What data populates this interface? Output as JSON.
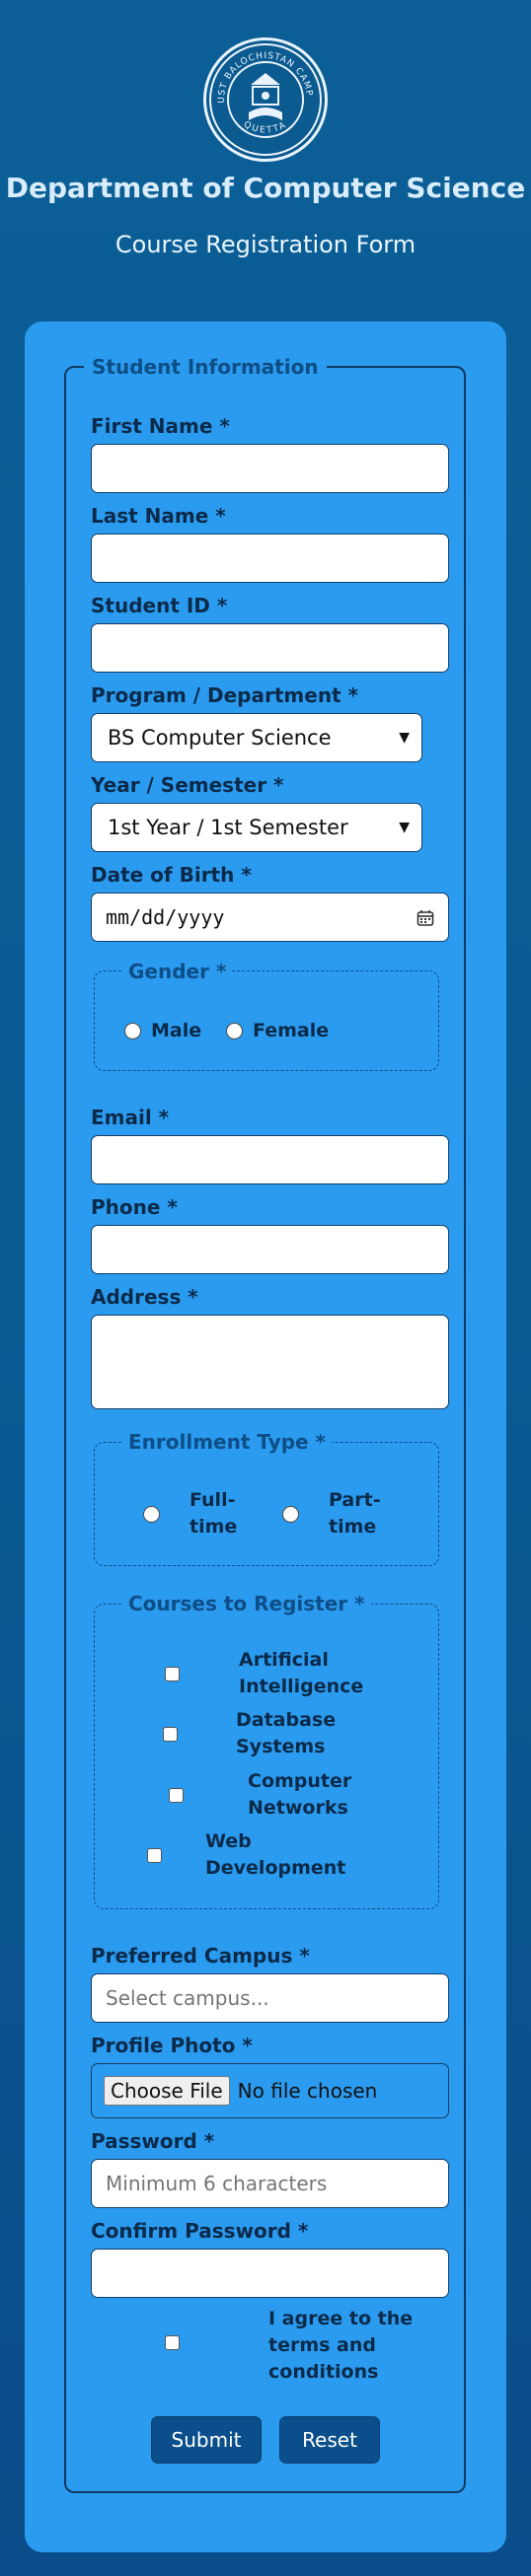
{
  "header": {
    "logo_text_top": "NUST BALOCHISTAN CAMPUS",
    "logo_text_bottom": "QUETTA",
    "department": "Department of Computer Science",
    "subtitle": "Course Registration Form"
  },
  "form": {
    "legend": "Student Information",
    "first_name": {
      "label": "First Name *",
      "value": ""
    },
    "last_name": {
      "label": "Last Name *",
      "value": ""
    },
    "student_id": {
      "label": "Student ID *",
      "value": ""
    },
    "program": {
      "label": "Program / Department *",
      "selected": "BS Computer Science"
    },
    "year": {
      "label": "Year / Semester *",
      "selected": "1st Year / 1st Semester"
    },
    "dob": {
      "label": "Date of Birth *",
      "placeholder": "mm/dd/yyyy"
    },
    "gender": {
      "legend": "Gender *",
      "options": [
        "Male",
        "Female"
      ]
    },
    "email": {
      "label": "Email *",
      "value": ""
    },
    "phone": {
      "label": "Phone *",
      "value": ""
    },
    "address": {
      "label": "Address *",
      "value": ""
    },
    "enrollment": {
      "legend": "Enrollment Type *",
      "options": [
        "Full-time",
        "Part-time"
      ]
    },
    "courses": {
      "legend": "Courses to Register *",
      "options": [
        "Artificial Intelligence",
        "Database Systems",
        "Computer Networks",
        "Web Development"
      ]
    },
    "campus": {
      "label": "Preferred Campus *",
      "placeholder": "Select campus..."
    },
    "photo": {
      "label": "Profile Photo *",
      "button": "Choose File",
      "status": "No file chosen"
    },
    "password": {
      "label": "Password *",
      "placeholder": "Minimum 6 characters"
    },
    "confirm_password": {
      "label": "Confirm Password *",
      "value": ""
    },
    "terms": "I agree to the terms and conditions",
    "submit": "Submit",
    "reset": "Reset"
  },
  "colors": {
    "page_bg": "#0b5f96",
    "card_bg": "#2b9bef",
    "button_bg": "#0a4f8b",
    "accent": "#0e4e86"
  }
}
